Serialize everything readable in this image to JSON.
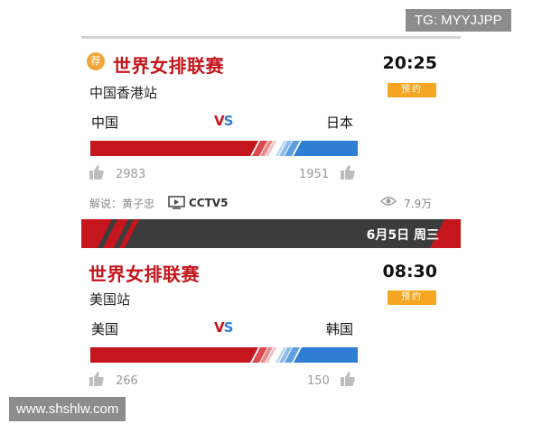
{
  "watermark_top": "TG: MYYJJPP",
  "watermark_bottom": "www.shshlw.com",
  "match1": {
    "badge": "荐",
    "league": "世界女排联赛",
    "stage": "中国香港站",
    "time": "20:25",
    "reserve": "预约",
    "home": "中国",
    "away": "日本",
    "vs_v": "V",
    "vs_s": "S",
    "home_likes": "2983",
    "away_likes": "1951",
    "commentary": "解说：黄子忠",
    "channel": "CCTV5",
    "views": "7.9万"
  },
  "date_header": "6月5日 周三",
  "match2": {
    "league": "世界女排联赛",
    "stage": "美国站",
    "time": "08:30",
    "reserve": "预约",
    "home": "美国",
    "away": "韩国",
    "vs_v": "V",
    "vs_s": "S",
    "home_likes": "266",
    "away_likes": "150"
  },
  "colors": {
    "red": "#c4161c",
    "blue": "#2e7fd4",
    "orange": "#f5a623"
  },
  "icons": [
    "recommend-badge-icon",
    "thumbs-up-icon",
    "tv-icon",
    "eye-icon"
  ]
}
